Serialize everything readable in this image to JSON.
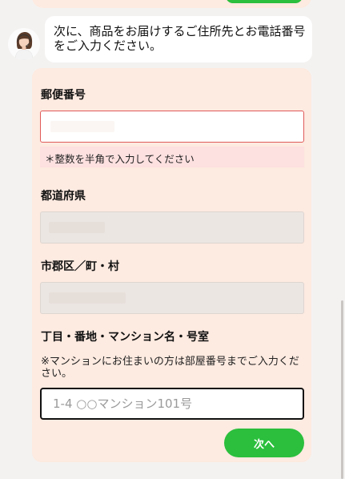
{
  "chat": {
    "message": "次に、商品をお届けするご住所先とお電話番号をご入力ください。"
  },
  "form": {
    "zip": {
      "label": "郵便番号",
      "error": "＊整数を半角で入力してください"
    },
    "prefecture": {
      "label": "都道府県"
    },
    "city": {
      "label": "市郡区／町・村"
    },
    "address": {
      "label": "丁目・番地・マンション名・号室",
      "note": "※マンションにお住まいの方は部屋番号までご入力ください。",
      "placeholder": "1-4 ○○マンション101号"
    },
    "next_label": "次へ"
  },
  "colors": {
    "accent_green": "#2bbf3d",
    "card_bg": "#fdeae0",
    "error_border": "#e05a5a",
    "error_bg": "#fde0e0"
  },
  "icons": {
    "operator": "operator-avatar-icon"
  }
}
